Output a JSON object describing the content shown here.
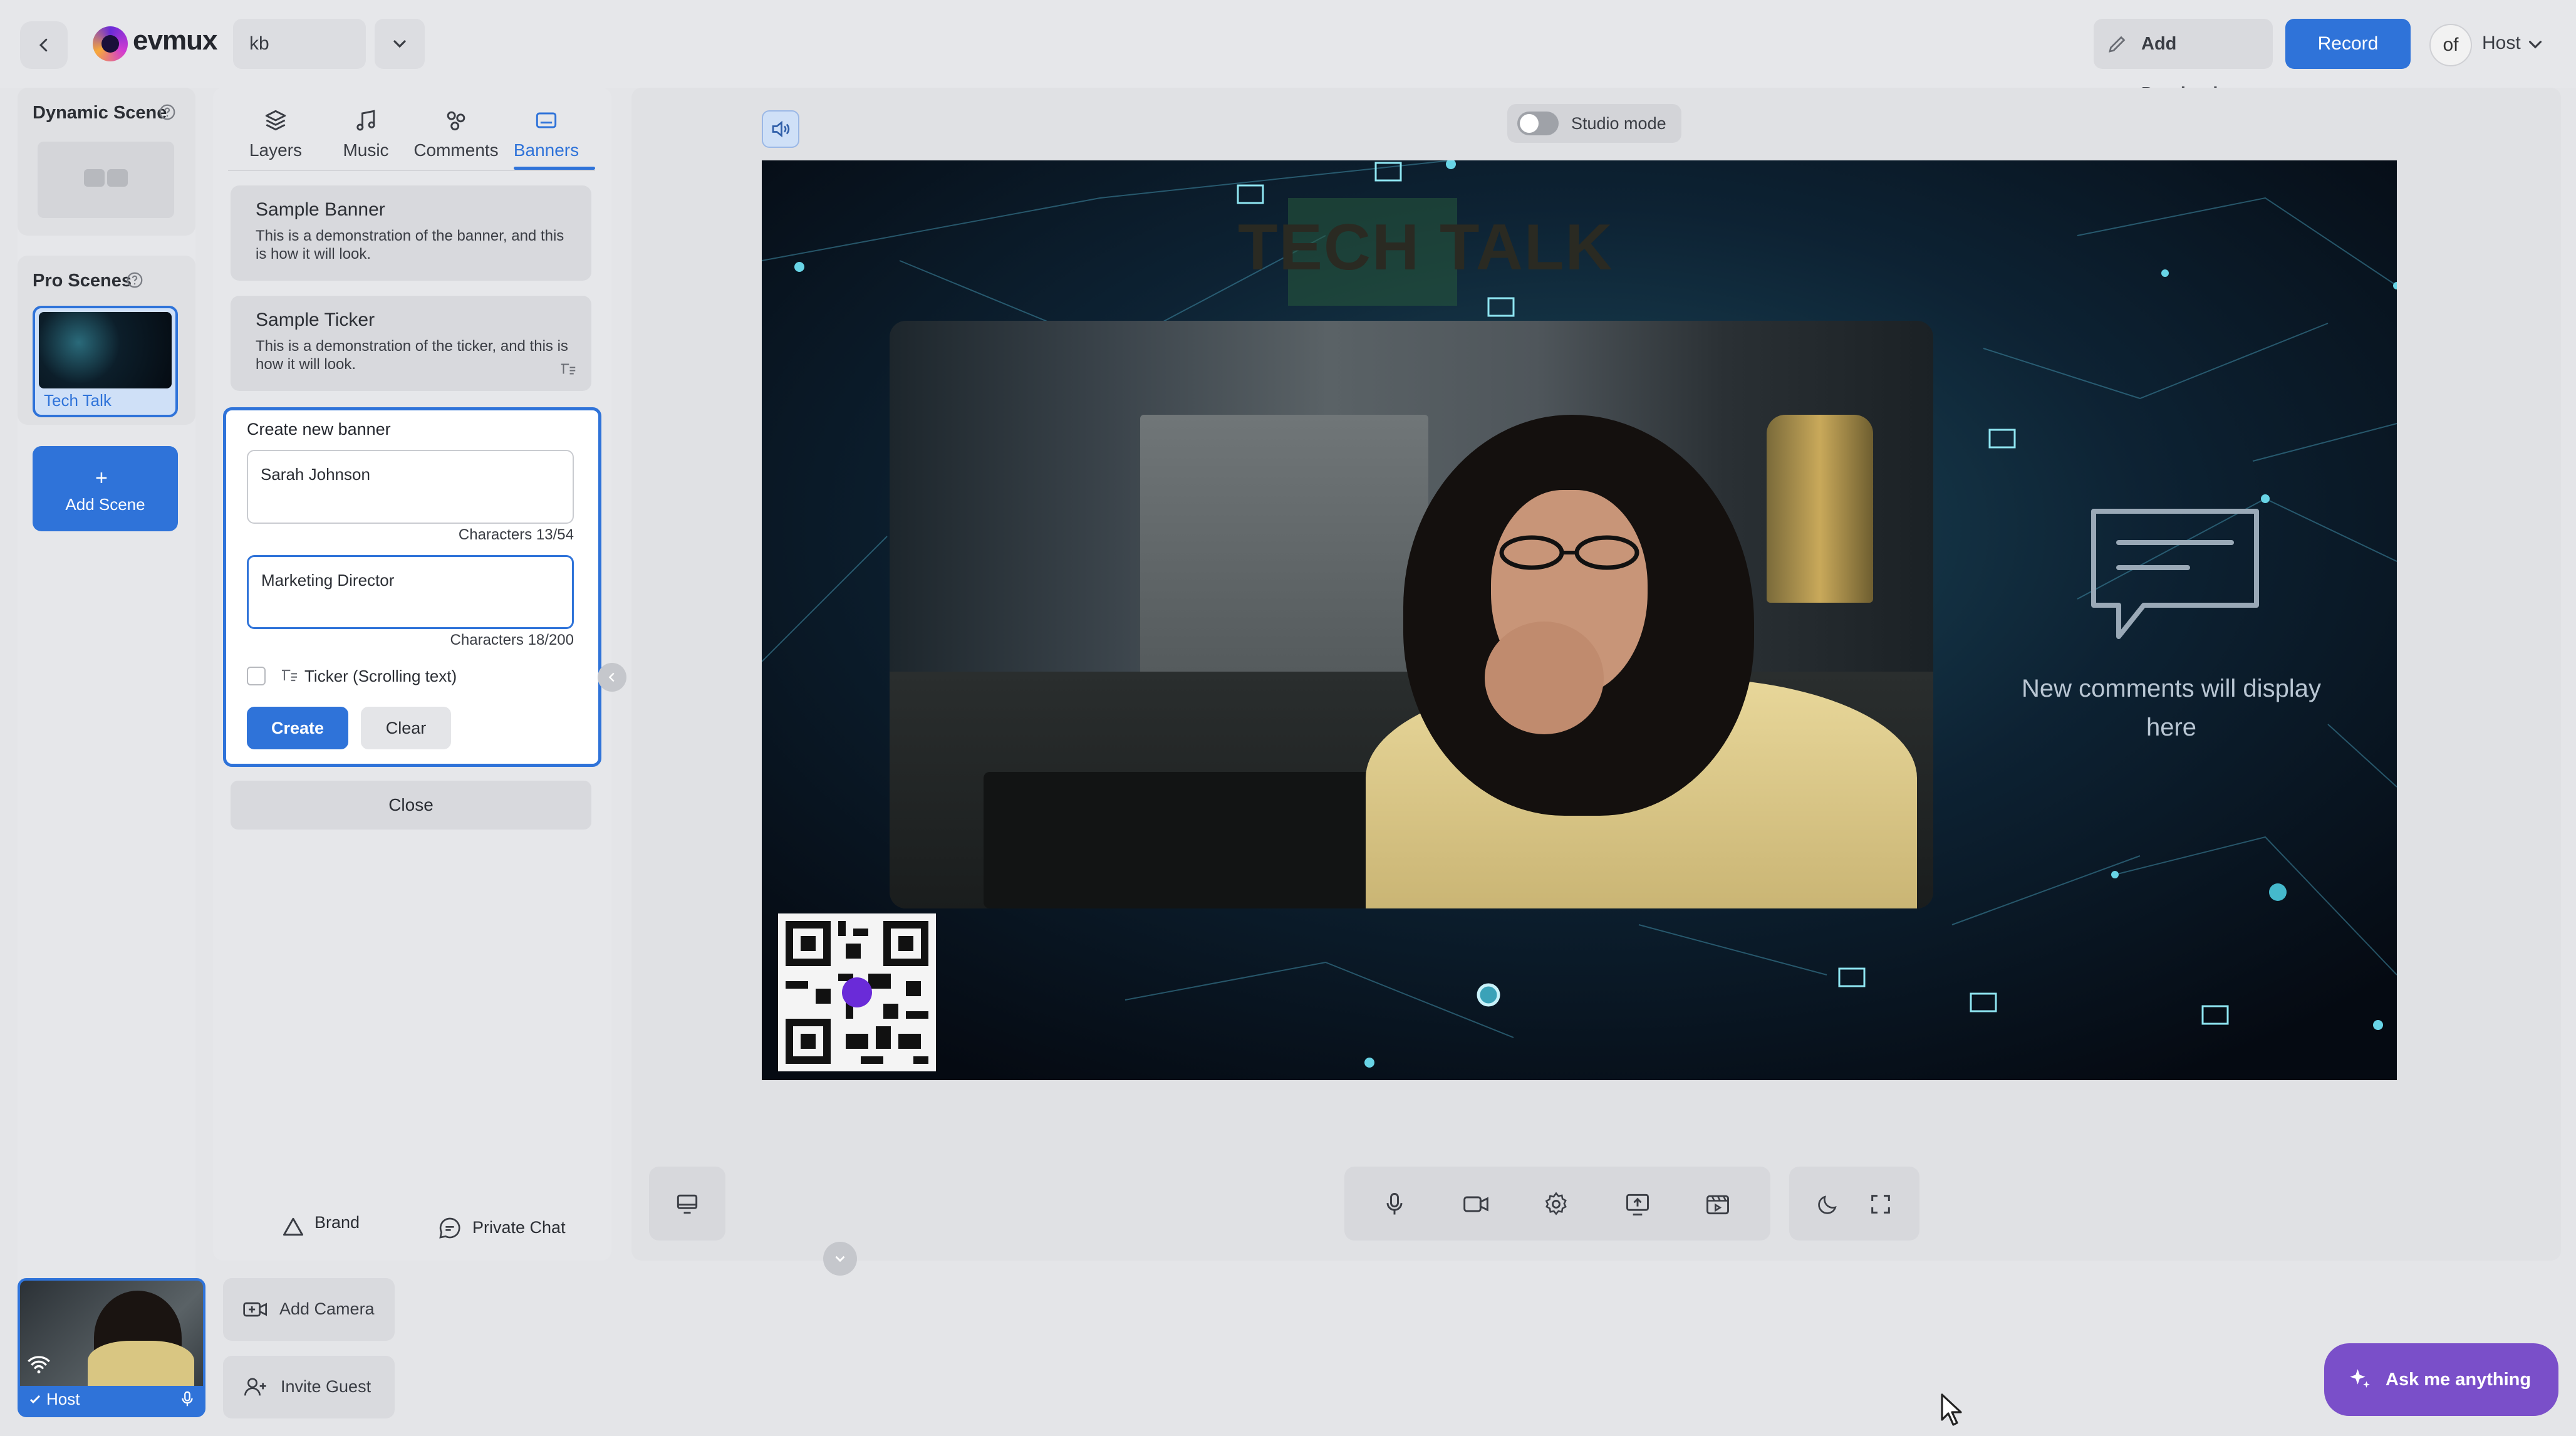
{
  "topbar": {
    "brand": "evmux",
    "studio_name": "kb",
    "add_destination": "Add Destination",
    "record": "Record",
    "avatar_text": "of",
    "host_label": "Host"
  },
  "scenes": {
    "dynamic_title": "Dynamic Scene",
    "pro_title": "Pro Scenes",
    "pro_items": [
      {
        "label": "Tech Talk",
        "selected": true
      }
    ],
    "add_scene_plus": "+",
    "add_scene": "Add Scene"
  },
  "panel": {
    "tabs": [
      {
        "label": "Layers",
        "icon": "layers-icon"
      },
      {
        "label": "Music",
        "icon": "music-icon"
      },
      {
        "label": "Comments",
        "icon": "comments-icon"
      },
      {
        "label": "Banners",
        "icon": "banner-icon",
        "active": true
      }
    ],
    "banners": [
      {
        "title": "Sample Banner",
        "desc": "This is a demonstration of the banner, and this is how it will look."
      },
      {
        "title": "Sample Ticker",
        "desc": "This is a demonstration of the ticker, and this is how it will look."
      }
    ],
    "create": {
      "title": "Create new banner",
      "name_value": "Sarah Johnson",
      "name_count": "Characters 13/54",
      "subtitle_value": "Marketing Director",
      "subtitle_count": "Characters 18/200",
      "ticker_label": "Ticker (Scrolling text)",
      "create_btn": "Create",
      "clear_btn": "Clear"
    },
    "close": "Close",
    "brand": "Brand",
    "private_chat": "Private Chat"
  },
  "stage": {
    "studio_mode": "Studio mode",
    "overlay_title": "TECH TALK",
    "comments_placeholder_line1": "New comments will display",
    "comments_placeholder_line2": "here"
  },
  "bottom": {
    "host_label": "Host",
    "add_camera": "Add Camera",
    "invite_guest": "Invite Guest",
    "ask": "Ask me anything"
  },
  "colors": {
    "accent": "#2f73d9",
    "assistant": "#7a4fc9",
    "stage_bg": "#0a1320"
  }
}
